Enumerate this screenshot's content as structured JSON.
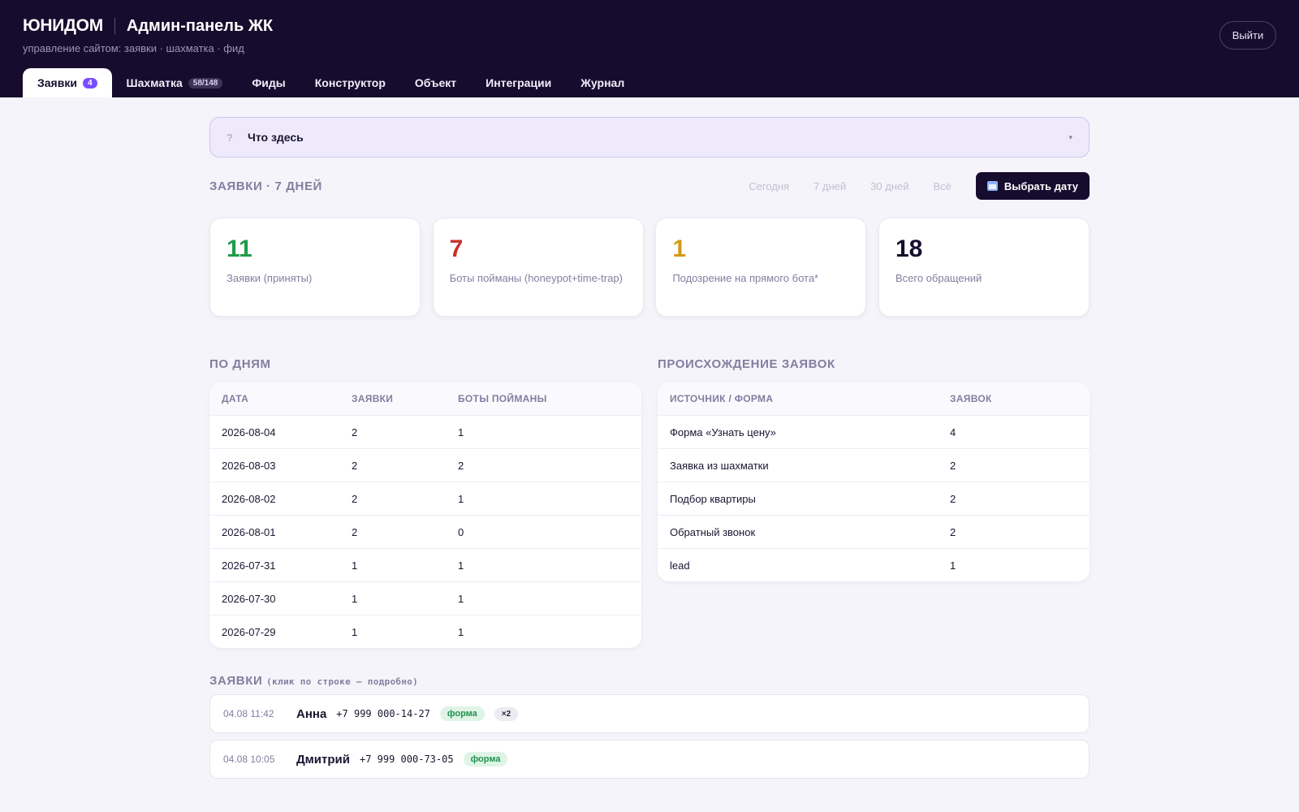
{
  "header": {
    "brand": "ЮНИДОМ",
    "title": "Админ-панель ЖК",
    "subtitle": "управление сайтом: заявки · шахматка · фид",
    "logout_label": "Выйти"
  },
  "tabs": [
    {
      "label": "Заявки",
      "badge": "4",
      "active": true
    },
    {
      "label": "Шахматка",
      "badge": "58/148"
    },
    {
      "label": "Фиды"
    },
    {
      "label": "Конструктор"
    },
    {
      "label": "Объект"
    },
    {
      "label": "Интеграции"
    },
    {
      "label": "Журнал"
    }
  ],
  "help": {
    "icon": "?",
    "label": "Что здесь",
    "caret": "▾"
  },
  "leads_section": {
    "title": "ЗАЯВКИ · 7 ДНЕЙ",
    "periods": [
      "Сегодня",
      "7 дней",
      "30 дней",
      "Всё"
    ],
    "pick_date_label": "Выбрать дату"
  },
  "stats": [
    {
      "value": "11",
      "label": "Заявки (приняты)",
      "color": "#1f9b4a"
    },
    {
      "value": "7",
      "label": "Боты пойманы (honeypot+time-trap)",
      "color": "#c8322a"
    },
    {
      "value": "1",
      "label": "Подозрение на прямого бота*",
      "color": "#d59a12"
    },
    {
      "value": "18",
      "label": "Всего обращений",
      "color": "#160d2e"
    }
  ],
  "by_day": {
    "title": "ПО ДНЯМ",
    "columns": [
      "ДАТА",
      "ЗАЯВКИ",
      "БОТЫ ПОЙМАНЫ"
    ],
    "rows": [
      [
        "2026-08-04",
        "2",
        "1"
      ],
      [
        "2026-08-03",
        "2",
        "2"
      ],
      [
        "2026-08-02",
        "2",
        "1"
      ],
      [
        "2026-08-01",
        "2",
        "0"
      ],
      [
        "2026-07-31",
        "1",
        "1"
      ],
      [
        "2026-07-30",
        "1",
        "1"
      ],
      [
        "2026-07-29",
        "1",
        "1"
      ]
    ]
  },
  "origin": {
    "title": "ПРОИСХОЖДЕНИЕ ЗАЯВОК",
    "columns": [
      "ИСТОЧНИК / ФОРМА",
      "ЗАЯВОК"
    ],
    "rows": [
      [
        "Форма «Узнать цену»",
        "4"
      ],
      [
        "Заявка из шахматки",
        "2"
      ],
      [
        "Подбор квартиры",
        "2"
      ],
      [
        "Обратный звонок",
        "2"
      ],
      [
        "lead",
        "1"
      ]
    ]
  },
  "leads_list": {
    "title": "ЗАЯВКИ",
    "hint": "(клик по строке — подробно)",
    "items": [
      {
        "time": "04.08 11:42",
        "name": "Анна",
        "phone": "+7 999 000-14-27",
        "tag": "форма",
        "dup": "×2"
      },
      {
        "time": "04.08 10:05",
        "name": "Дмитрий",
        "phone": "+7 999 000-73-05",
        "tag": "форма"
      }
    ]
  }
}
